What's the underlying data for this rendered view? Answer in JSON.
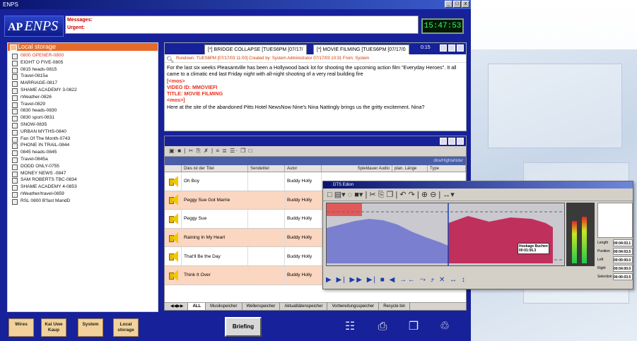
{
  "window": {
    "title": "ENPS",
    "controls": [
      "_",
      "□",
      "x"
    ]
  },
  "logo": {
    "ap": "AP",
    "name": "ENPS"
  },
  "messages": {
    "messages_label": "Messages:",
    "urgent_label": "Urgent:"
  },
  "clock": "15:47:53",
  "local_storage": {
    "header": "Local storage",
    "items": [
      "0800 OPENER-0800",
      "EIGHT O FIVE-0805",
      "0815 heads-0815",
      "Travel-0815a",
      "MARRIAGE-0817",
      "SHAME ACADEMY 3-0822",
      "rWeather-0826",
      "Travel-0829",
      "0830 heads-0830",
      "0830 sport-0831",
      "SNOW-0835",
      "URBAN MYTHS-0840",
      "Fan Of The Month-0743",
      "PHONE IN TRAIL-0844",
      "0845 heads-0845",
      "Travel-0845a",
      "DODD ONLY-0755",
      "MONEY NEWS -0847",
      "SAM ROBERTS TBC-0834",
      "SHAME ACADEMY 4-0853",
      "rWeather/travel-0859",
      "RSL 0800 B'fast MandD"
    ]
  },
  "story_panel": {
    "tabs": [
      "[*] BRIDGE COLLAPSE [TUES6PM [07/17/",
      "[*] MOVIE FILMING [TUES6PM [07/17/0"
    ],
    "time": "0:15",
    "meta": "Rundown: TUES6PM [07/17/03 11:00]  Created by: System Administrator 07/17/03 10:31  From: System",
    "body_1": "For the last six weeks Pleasantville has been a Hollywood back lot for shooting the upcoming action film \"Everyday Heroes\". It all came to a climatic end last Friday night with all-night shooting of a very real building fire",
    "mos_open": "[<mos>",
    "video_id": "VIDEO ID: MMOVIEFI",
    "title_line": "TITLE: MOVIE FILMING",
    "mos_close": "<mos>]",
    "body_2": "Here at the site of the abandoned Pitts Hotel NewsNow Nine's Nina Nattingly brings us the gritty excitement.  Nina?"
  },
  "media_panel": {
    "toolbar": "▣·■ | ✂ ⎘ ✗ | ≡ ≣ ☰· ❐ □",
    "sub_header": "dira/HighlaNder",
    "columns": [
      "",
      "Dies ist der Titel",
      "Sendetitel",
      "Autor",
      "Spieldauer Audio",
      "plan. Länge",
      "Type"
    ],
    "rows": [
      {
        "title": "Oh Boy",
        "author": "Buddy Holly"
      },
      {
        "title": "Peggy Sue Got Marrie",
        "author": "Buddy Holly"
      },
      {
        "title": "Peggy Sue",
        "author": "Buddy Holly"
      },
      {
        "title": "Raining In My Heart",
        "author": "Buddy Holly"
      },
      {
        "title": "That'll Be the Day",
        "author": "Buddy Holly"
      },
      {
        "title": "Think It Over",
        "author": "Buddy Holly"
      }
    ],
    "bottom_tabs": [
      "ALL",
      "Musikspeicher",
      "Wellenspeicher",
      "Aktualitätenspeicher",
      "Vorbereitungsspeicher",
      "Recycle bin"
    ]
  },
  "audio_editor": {
    "title": "DTS Edion",
    "tool_icons": "□ ▤▾ ◌ ■▾ | ✂ ⎘ ❐ | ↶ ↷ | ⊕ ⊖ | ↔▾",
    "marker_label": "Hookage Buchen",
    "marker_time": "00:01:55.3",
    "transport_icons": "▶ ▶| ▶▶ ▶| ■ ◀ →← ⤳ ⤴ ✕ ↔ ↕",
    "info_labels": [
      "Length",
      "Position",
      "Left",
      "Right",
      "Selection"
    ],
    "info_values": [
      "00:04:03.1",
      "00:04:03.5",
      "00:00:00.0",
      "00:04:00.0",
      "00:00:03.5"
    ]
  },
  "dock": {
    "wires": "Wires",
    "kai": "Kai Uwe Kaup",
    "system": "System",
    "local": "Local storage",
    "briefing": "Briefing"
  },
  "colors": {
    "app_blue": "#17219a",
    "accent_orange": "#e86a28",
    "highlight_row": "#fbd6c0",
    "clock_green": "#33ff66"
  }
}
